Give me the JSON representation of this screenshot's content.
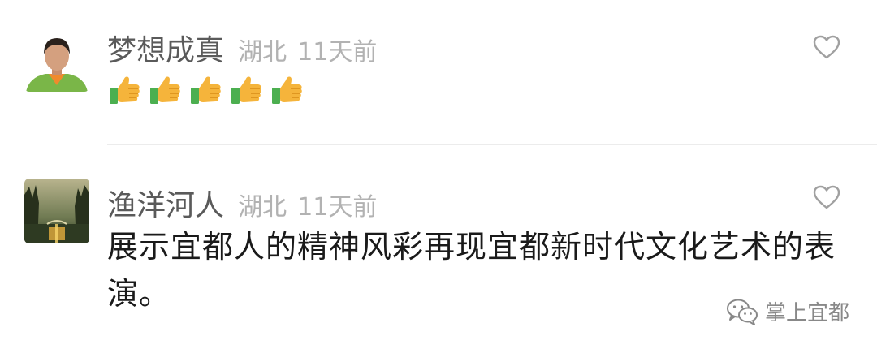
{
  "comments": [
    {
      "name": "梦想成真",
      "location": "湖北",
      "time": "11天前",
      "content_emojis": [
        "thumbs-up",
        "thumbs-up",
        "thumbs-up",
        "thumbs-up",
        "thumbs-up"
      ]
    },
    {
      "name": "渔洋河人",
      "location": "湖北",
      "time": "11天前",
      "text": "展示宜都人的精神风彩再现宜都新时代文化艺术的表演。"
    }
  ],
  "watermark": {
    "label": "掌上宜都",
    "icon": "wechat-icon"
  },
  "colors": {
    "name": "#5a5a5a",
    "meta": "#b2b2b2",
    "text": "#1a1a1a",
    "divider": "#ececec"
  }
}
